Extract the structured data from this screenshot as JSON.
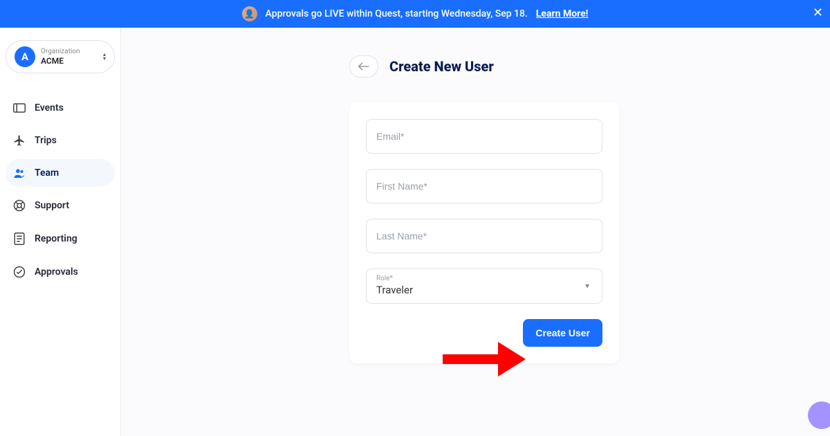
{
  "banner": {
    "text": "Approvals go LIVE within Quest, starting Wednesday, Sep 18.",
    "link_text": "Learn More!"
  },
  "org": {
    "badge_letter": "A",
    "label": "Organization",
    "name": "ACME"
  },
  "nav": {
    "items": [
      {
        "label": "Events"
      },
      {
        "label": "Trips"
      },
      {
        "label": "Team"
      },
      {
        "label": "Support"
      },
      {
        "label": "Reporting"
      },
      {
        "label": "Approvals"
      }
    ],
    "active_index": 2
  },
  "page": {
    "title": "Create New User"
  },
  "form": {
    "email_placeholder": "Email*",
    "firstname_placeholder": "First Name*",
    "lastname_placeholder": "Last Name*",
    "role_label": "Role*",
    "role_value": "Traveler",
    "submit_label": "Create User"
  }
}
